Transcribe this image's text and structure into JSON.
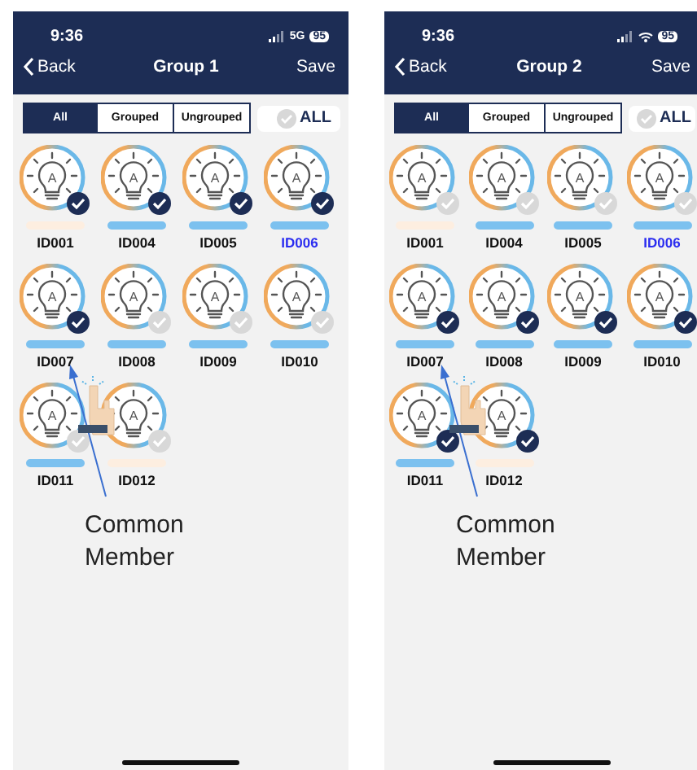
{
  "screens": [
    {
      "time": "9:36",
      "network": "5G",
      "battery": "95",
      "back": "Back",
      "title": "Group 1",
      "save": "Save",
      "filters": [
        {
          "label": "All",
          "selected": true
        },
        {
          "label": "Grouped",
          "selected": false
        },
        {
          "label": "Ungrouped",
          "selected": false
        }
      ],
      "select_all": {
        "label": "ALL",
        "checked": false
      },
      "devices": [
        {
          "id": "ID001",
          "letter": "A",
          "checked": true,
          "color": "#fdeee0",
          "highlighted": false
        },
        {
          "id": "ID004",
          "letter": "A",
          "checked": true,
          "color": "#7cc1ef",
          "highlighted": false
        },
        {
          "id": "ID005",
          "letter": "A",
          "checked": true,
          "color": "#7cc1ef",
          "highlighted": false
        },
        {
          "id": "ID006",
          "letter": "A",
          "checked": true,
          "color": "#7cc1ef",
          "highlighted": true
        },
        {
          "id": "ID007",
          "letter": "A",
          "checked": true,
          "color": "#7cc1ef",
          "highlighted": false
        },
        {
          "id": "ID008",
          "letter": "A",
          "checked": false,
          "color": "#7cc1ef",
          "highlighted": false
        },
        {
          "id": "ID009",
          "letter": "A",
          "checked": false,
          "color": "#7cc1ef",
          "highlighted": false
        },
        {
          "id": "ID010",
          "letter": "A",
          "checked": false,
          "color": "#7cc1ef",
          "highlighted": false
        },
        {
          "id": "ID011",
          "letter": "A",
          "checked": false,
          "color": "#7cc1ef",
          "highlighted": false
        },
        {
          "id": "ID012",
          "letter": "A",
          "checked": false,
          "color": "#fdeee0",
          "highlighted": false
        }
      ],
      "annotation": "Common Member"
    },
    {
      "time": "9:36",
      "battery": "95",
      "back": "Back",
      "title": "Group 2",
      "save": "Save",
      "filters": [
        {
          "label": "All",
          "selected": true
        },
        {
          "label": "Grouped",
          "selected": false
        },
        {
          "label": "Ungrouped",
          "selected": false
        }
      ],
      "select_all": {
        "label": "ALL",
        "checked": false
      },
      "devices": [
        {
          "id": "ID001",
          "letter": "A",
          "checked": false,
          "color": "#fdeee0",
          "highlighted": false
        },
        {
          "id": "ID004",
          "letter": "A",
          "checked": false,
          "color": "#7cc1ef",
          "highlighted": false
        },
        {
          "id": "ID005",
          "letter": "A",
          "checked": false,
          "color": "#7cc1ef",
          "highlighted": false
        },
        {
          "id": "ID006",
          "letter": "A",
          "checked": false,
          "color": "#7cc1ef",
          "highlighted": true
        },
        {
          "id": "ID007",
          "letter": "A",
          "checked": true,
          "color": "#7cc1ef",
          "highlighted": false
        },
        {
          "id": "ID008",
          "letter": "A",
          "checked": true,
          "color": "#7cc1ef",
          "highlighted": false
        },
        {
          "id": "ID009",
          "letter": "A",
          "checked": true,
          "color": "#7cc1ef",
          "highlighted": false
        },
        {
          "id": "ID010",
          "letter": "A",
          "checked": true,
          "color": "#7cc1ef",
          "highlighted": false
        },
        {
          "id": "ID011",
          "letter": "A",
          "checked": true,
          "color": "#7cc1ef",
          "highlighted": false
        },
        {
          "id": "ID012",
          "letter": "A",
          "checked": true,
          "color": "#fdeee0",
          "highlighted": false
        }
      ],
      "annotation": "Common Member"
    }
  ]
}
